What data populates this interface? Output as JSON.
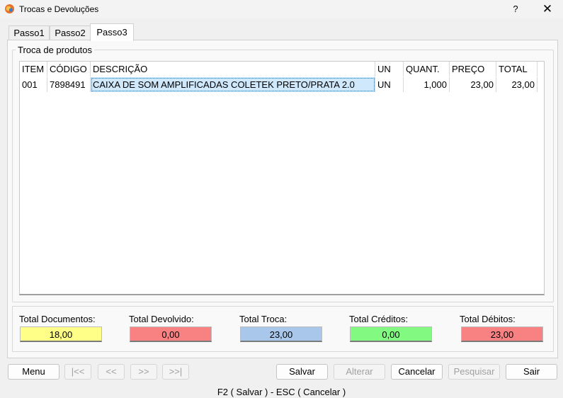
{
  "window": {
    "title": "Trocas e Devoluções",
    "help": "?",
    "close": "✕"
  },
  "tabs": [
    {
      "label": "Passo1"
    },
    {
      "label": "Passo2"
    },
    {
      "label": "Passo3",
      "active": true
    }
  ],
  "group": {
    "title": "Troca de produtos"
  },
  "table": {
    "columns": [
      "ITEM",
      "CÓDIGO",
      "DESCRIÇÃO",
      "UN",
      "QUANT.",
      "PREÇO",
      "TOTAL"
    ],
    "rows": [
      {
        "item": "001",
        "codigo": "7898491",
        "descricao": "CAIXA DE SOM AMPLIFICADAS COLETEK PRETO/PRATA 2.0",
        "un": "UN",
        "quant": "1,000",
        "preco": "23,00",
        "total": "23,00"
      }
    ]
  },
  "totals": [
    {
      "label": "Total Documentos:",
      "value": "18,00",
      "color": "#ffff88"
    },
    {
      "label": "Total Devolvido:",
      "value": "0,00",
      "color": "#f88282"
    },
    {
      "label": "Total Troca:",
      "value": "23,00",
      "color": "#a9c7ea"
    },
    {
      "label": "Total Créditos:",
      "value": "0,00",
      "color": "#82fa82"
    },
    {
      "label": "Total Débitos:",
      "value": "23,00",
      "color": "#f88282"
    }
  ],
  "buttons": {
    "menu": "Menu",
    "first": "|<<",
    "prev": "<<",
    "next": ">>",
    "last": ">>|",
    "salvar": "Salvar",
    "alterar": "Alterar",
    "cancelar": "Cancelar",
    "pesquisar": "Pesquisar",
    "sair": "Sair"
  },
  "status": {
    "text": "F2 ( Salvar )  -  ESC ( Cancelar )"
  }
}
